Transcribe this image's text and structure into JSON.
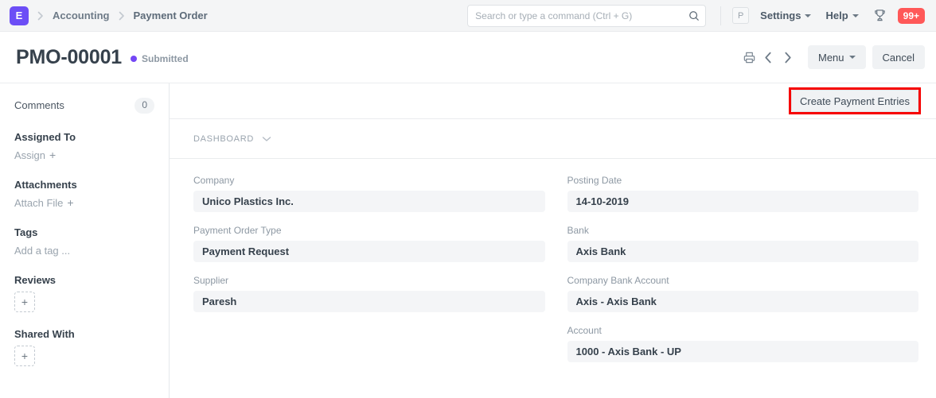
{
  "navbar": {
    "logo_letter": "E",
    "breadcrumbs": [
      {
        "label": "Accounting"
      },
      {
        "label": "Payment Order"
      }
    ],
    "search": {
      "placeholder": "Search or type a command (Ctrl + G)",
      "value": "",
      "icon": "search-icon"
    },
    "avatar_letter": "P",
    "items": [
      {
        "label": "Settings"
      },
      {
        "label": "Help"
      }
    ],
    "trophy_icon": "trophy-icon",
    "notification_count": "99+"
  },
  "page_head": {
    "title": "PMO-00001",
    "status": "Submitted",
    "status_color": "#7447f5",
    "print_icon": "print-icon",
    "prev_icon": "chevron-left-icon",
    "next_icon": "chevron-right-icon",
    "menu_label": "Menu",
    "cancel_label": "Cancel"
  },
  "sidebar": {
    "comments_label": "Comments",
    "comments_count": "0",
    "assigned_to_label": "Assigned To",
    "assign_action": "Assign",
    "attachments_label": "Attachments",
    "attach_action": "Attach File",
    "tags_label": "Tags",
    "tags_action": "Add a tag ...",
    "reviews_label": "Reviews",
    "reviews_add": "+",
    "shared_with_label": "Shared With",
    "shared_with_add": "+"
  },
  "main": {
    "create_payment_entries_label": "Create Payment Entries",
    "highlight_color": "#f60000",
    "dashboard_label": "DASHBOARD",
    "fields_left": [
      {
        "label": "Company",
        "value": "Unico Plastics Inc."
      },
      {
        "label": "Payment Order Type",
        "value": "Payment Request"
      },
      {
        "label": "Supplier",
        "value": "Paresh"
      }
    ],
    "fields_right": [
      {
        "label": "Posting Date",
        "value": "14-10-2019"
      },
      {
        "label": "Bank",
        "value": "Axis Bank"
      },
      {
        "label": "Company Bank Account",
        "value": "Axis - Axis Bank"
      },
      {
        "label": "Account",
        "value": "1000 - Axis Bank - UP"
      }
    ]
  }
}
